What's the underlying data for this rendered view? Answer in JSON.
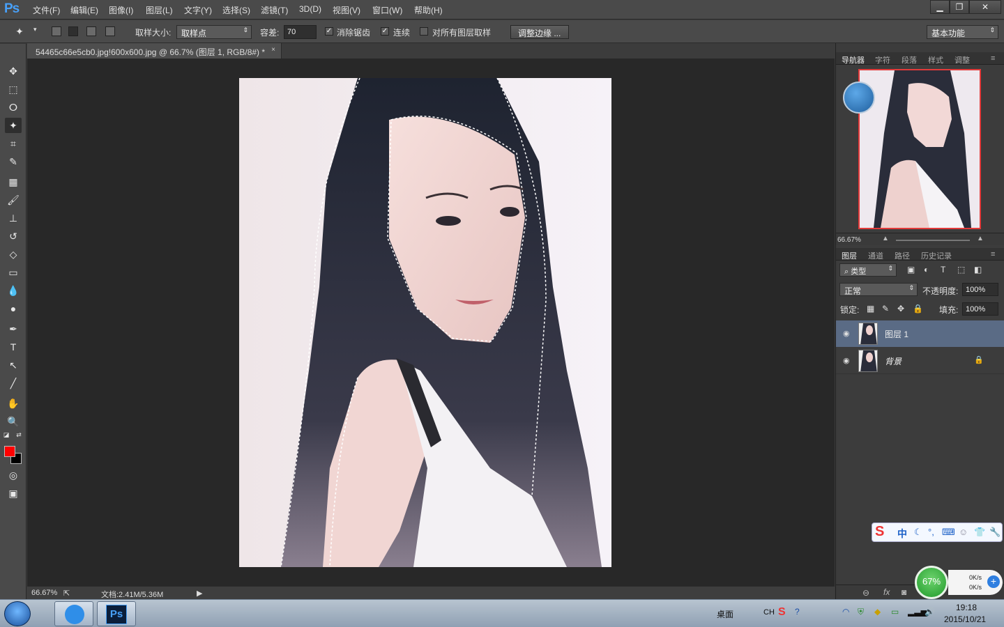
{
  "app": {
    "logo": "Ps"
  },
  "menu": [
    "文件(F)",
    "编辑(E)",
    "图像(I)",
    "图层(L)",
    "文字(Y)",
    "选择(S)",
    "滤镜(T)",
    "3D(D)",
    "视图(V)",
    "窗口(W)",
    "帮助(H)"
  ],
  "window_buttons": [
    "▁",
    "❐",
    "✕"
  ],
  "options": {
    "sample_size_label": "取样大小:",
    "sample_size_value": "取样点",
    "tolerance_label": "容差:",
    "tolerance_value": "70",
    "antialias_label": "消除锯齿",
    "contiguous_label": "连续",
    "all_layers_label": "对所有图层取样",
    "refine_edge_label": "调整边缘 ...",
    "workspace_value": "基本功能"
  },
  "document": {
    "tab_title": "54465c66e5cb0.jpg!600x600.jpg @ 66.7% (图层 1, RGB/8#) *",
    "close": "×"
  },
  "status": {
    "zoom": "66.67%",
    "doc_info": "文档:2.41M/5.36M"
  },
  "colors": {
    "foreground": "#ff0000",
    "background": "#000000"
  },
  "panels": {
    "navigator_tabs": [
      "导航器",
      "字符",
      "段落",
      "样式",
      "调整"
    ],
    "navigator_zoom": "66.67%",
    "layers_tabs": [
      "图层",
      "通道",
      "路径",
      "历史记录"
    ],
    "filter_kind": "类型",
    "blend_mode": "正常",
    "opacity_label": "不透明度:",
    "opacity_value": "100%",
    "lock_label": "锁定:",
    "fill_label": "填充:",
    "fill_value": "100%",
    "layers": [
      {
        "name": "图层 1",
        "selected": true
      },
      {
        "name": "背景",
        "selected": false
      }
    ],
    "footer_icons": [
      "link-icon",
      "fx-icon",
      "mask-icon"
    ],
    "fx_label": "fx"
  },
  "widgets": {
    "ime_label": "中",
    "cpu_gauge": "67%",
    "net_up": "0K/s",
    "net_down": "0K/s"
  },
  "taskbar": {
    "desktop_label": "桌面",
    "lang": "CH",
    "time": "19:18",
    "date": "2015/10/21"
  }
}
